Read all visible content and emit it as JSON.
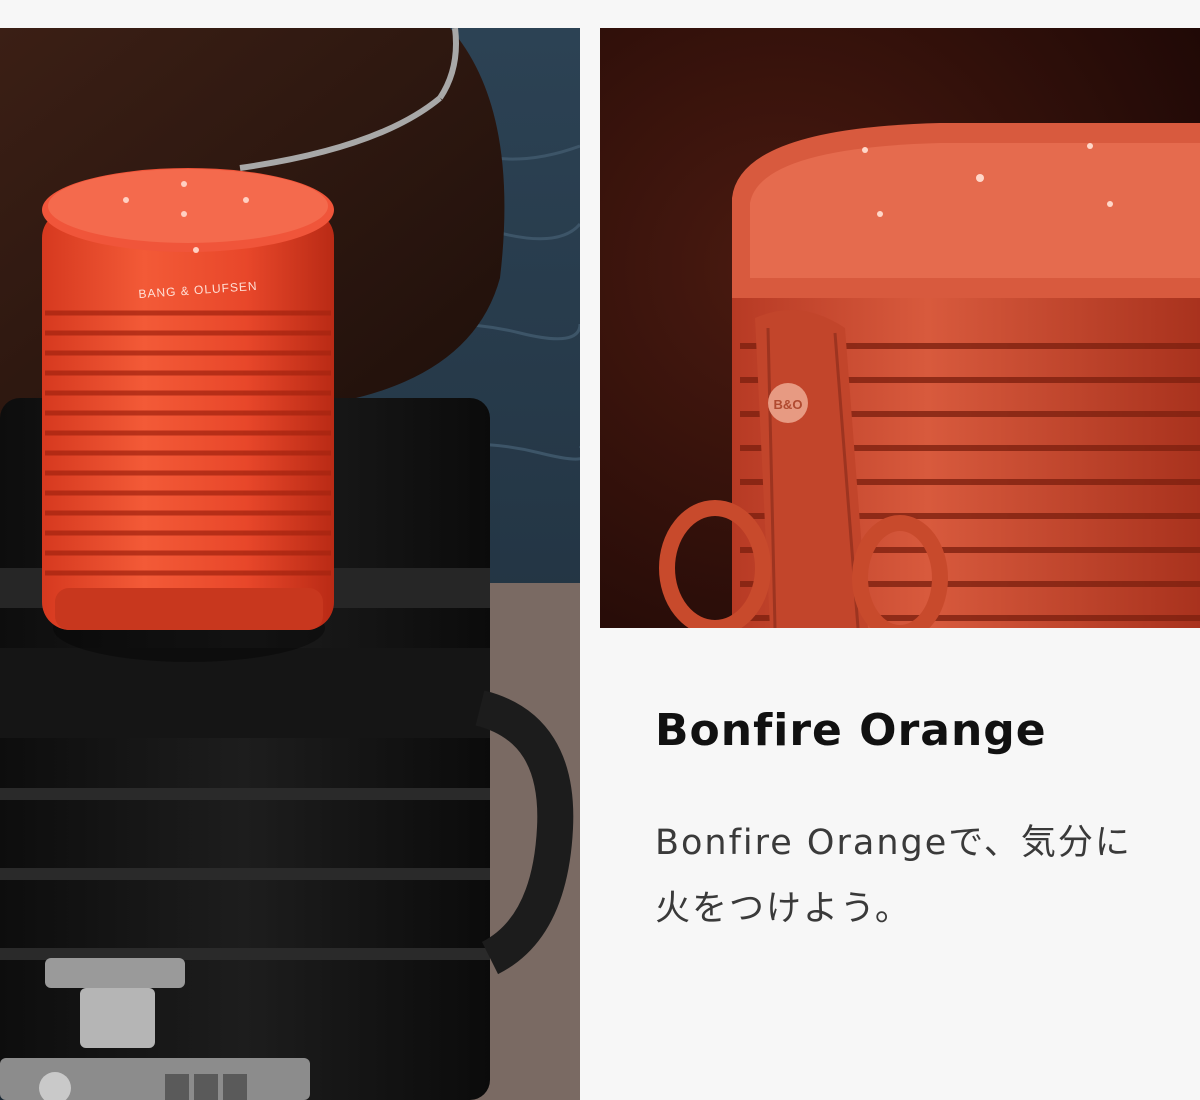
{
  "photos": {
    "left": {
      "speaker_brand": "BANG & OLUFSEN"
    },
    "right": {
      "badge": "B&O"
    }
  },
  "product": {
    "title": "Bonfire Orange",
    "description": "Bonfire Orangeで、気分に火をつけよう。"
  },
  "colors": {
    "accent": "#e8412a",
    "text": "#111111",
    "background": "#f7f7f7"
  }
}
